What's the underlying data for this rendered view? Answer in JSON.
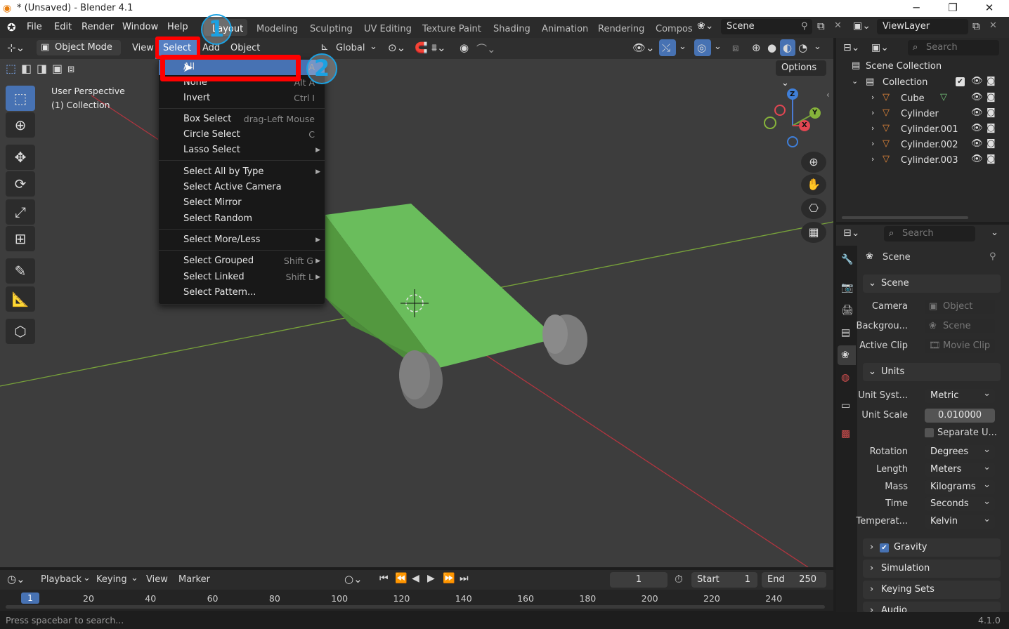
{
  "window": {
    "title": "* (Unsaved) - Blender 4.1",
    "minimize_glyph": "─",
    "maximize_glyph": "❐",
    "close_glyph": "✕"
  },
  "menubar": {
    "items": [
      "File",
      "Edit",
      "Render",
      "Window",
      "Help"
    ]
  },
  "workspaces": {
    "tabs": [
      "Layout",
      "Modeling",
      "Sculpting",
      "UV Editing",
      "Texture Paint",
      "Shading",
      "Animation",
      "Rendering",
      "Compos"
    ]
  },
  "scene_selector": {
    "value": "Scene"
  },
  "viewlayer_selector": {
    "value": "ViewLayer"
  },
  "viewport_header": {
    "mode": "Object Mode",
    "menus": [
      "View",
      "Select",
      "Add",
      "Object"
    ],
    "transform_orientation": "Global",
    "options_label": "Options"
  },
  "viewport": {
    "perspective_label": "User Perspective",
    "collection_label": "(1) Collection"
  },
  "select_menu": {
    "items": [
      {
        "label": "All",
        "shortcut": "A",
        "submenu": false
      },
      {
        "label": "None",
        "shortcut": "Alt A",
        "submenu": false
      },
      {
        "label": "Invert",
        "shortcut": "Ctrl I",
        "submenu": false
      },
      {
        "label": "Box Select",
        "shortcut": "drag-Left Mouse",
        "submenu": false
      },
      {
        "label": "Circle Select",
        "shortcut": "C",
        "submenu": false
      },
      {
        "label": "Lasso Select",
        "shortcut": "",
        "submenu": true
      },
      {
        "label": "Select All by Type",
        "shortcut": "",
        "submenu": true
      },
      {
        "label": "Select Active Camera",
        "shortcut": "",
        "submenu": false
      },
      {
        "label": "Select Mirror",
        "shortcut": "",
        "submenu": false
      },
      {
        "label": "Select Random",
        "shortcut": "",
        "submenu": false
      },
      {
        "label": "Select More/Less",
        "shortcut": "",
        "submenu": true
      },
      {
        "label": "Select Grouped",
        "shortcut": "Shift G",
        "submenu": true
      },
      {
        "label": "Select Linked",
        "shortcut": "Shift L",
        "submenu": true
      },
      {
        "label": "Select Pattern...",
        "shortcut": "",
        "submenu": false
      }
    ]
  },
  "annotations": {
    "step1": "1",
    "step2": "2",
    "highlight_color": "#ff0000",
    "badge_color": "#1ba1e2"
  },
  "outliner": {
    "search_placeholder": "Search",
    "root": "Scene Collection",
    "collection": "Collection",
    "objects": [
      "Cube",
      "Cylinder",
      "Cylinder.001",
      "Cylinder.002",
      "Cylinder.003"
    ]
  },
  "properties": {
    "search_placeholder": "Search",
    "context": "Scene",
    "scene_panel": {
      "title": "Scene",
      "camera_label": "Camera",
      "camera_value": "Object",
      "background_label": "Backgrou...",
      "background_value": "Scene",
      "clip_label": "Active Clip",
      "clip_value": "Movie Clip"
    },
    "units_panel": {
      "title": "Units",
      "unit_system_label": "Unit Syst...",
      "unit_system": "Metric",
      "unit_scale_label": "Unit Scale",
      "unit_scale": "0.010000",
      "separate_units": "Separate U...",
      "rotation_label": "Rotation",
      "rotation": "Degrees",
      "length_label": "Length",
      "length": "Meters",
      "mass_label": "Mass",
      "mass": "Kilograms",
      "time_label": "Time",
      "time": "Seconds",
      "temperature_label": "Temperat...",
      "temperature": "Kelvin"
    },
    "collapsed_panels": [
      "Gravity",
      "Simulation",
      "Keying Sets",
      "Audio"
    ]
  },
  "timeline": {
    "menus": [
      "Playback",
      "Keying",
      "View",
      "Marker"
    ],
    "current_frame": "1",
    "start_label": "Start",
    "start": "1",
    "end_label": "End",
    "end": "250",
    "ruler_current": "1",
    "ruler_ticks": [
      "20",
      "40",
      "60",
      "80",
      "100",
      "120",
      "140",
      "160",
      "180",
      "200",
      "220",
      "240"
    ]
  },
  "statusbar": {
    "hint": "Press spacebar to search...",
    "version": "4.1.0"
  },
  "colors": {
    "object_green": "#6abd5c",
    "wheel_gray": "#7b7b7b",
    "axis_x": "#b0353f",
    "axis_y": "#78a33a",
    "active_blue": "#4772b3"
  }
}
